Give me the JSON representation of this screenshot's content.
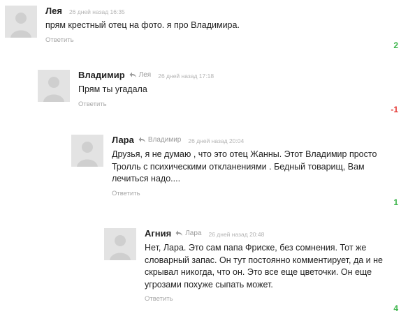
{
  "comments": [
    {
      "author": "Лея",
      "reply_to": "",
      "time": "26 дней назад 16:35",
      "text": "прям крестный отец на фото. я про Владимира.",
      "reply_label": "Ответить",
      "score": "2"
    },
    {
      "author": "Владимир",
      "reply_to": "Лея",
      "time": "26 дней назад 17:18",
      "text": "Прям ты угадала",
      "reply_label": "Ответить",
      "score": "-1"
    },
    {
      "author": "Лара",
      "reply_to": "Владимир",
      "time": "26 дней назад 20:04",
      "text": "Друзья, я не думаю , что это отец Жанны. Этот Владимир просто Тролль с психическими откланениями . Бедный товарищ, Вам лечиться надо....",
      "reply_label": "Ответить",
      "score": "1"
    },
    {
      "author": "Агния",
      "reply_to": "Лара",
      "time": "26 дней назад 20:48",
      "text": "Нет, Лара. Это сам папа Фриске, без сомнения. Тот же словарный запас. Он тут постоянно комментирует, да и не скрывал никогда, что он. Это все еще  цветочки. Он еще угрозами похуже сыпать может.",
      "reply_label": "Ответить",
      "score": "4"
    }
  ],
  "colors": {
    "positive_score": "#3bb54a",
    "negative_score": "#e53935",
    "avatar_bg": "#e3e3e3",
    "meta_text": "#b3b3b3"
  },
  "icons": {
    "avatar": "default-user-avatar-icon",
    "reply_arrow": "reply-arrow-icon"
  }
}
